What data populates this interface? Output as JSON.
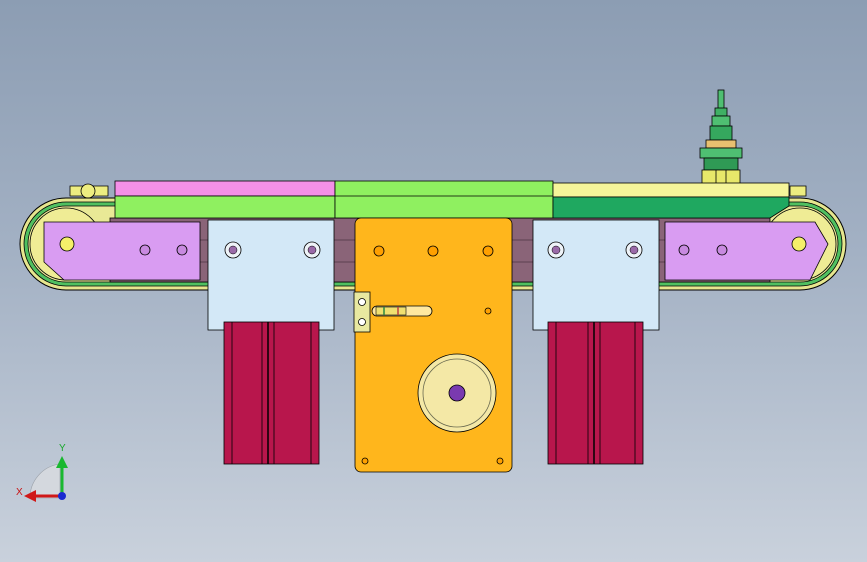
{
  "colors": {
    "bg_top": "#8c9db3",
    "bg_bottom": "#c9d1dc",
    "belt_pink": "#f490e8",
    "belt_green": "#8ff060",
    "belt_yellow": "#f5f59a",
    "belt_darkgreen": "#1fa860",
    "side_plate": "#d99cf2",
    "pulley": "#f0ee9a",
    "bracket": "#d3e8f7",
    "motor_plate": "#ffb61c",
    "cylinder": "#b8164c",
    "frame": "#8a6478",
    "sensor": "#4fbf72"
  },
  "triad": {
    "x_label": "X",
    "y_label": "Y",
    "icon": "coordinate-triad-icon"
  }
}
